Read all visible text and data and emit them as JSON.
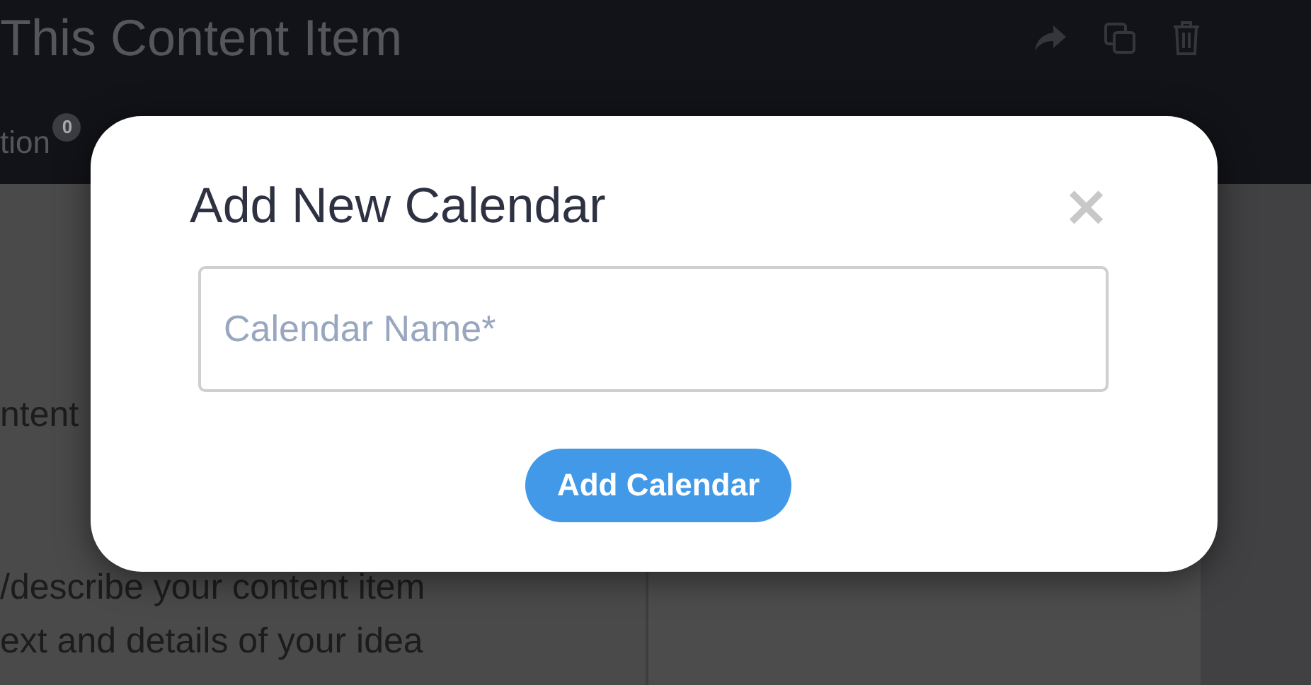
{
  "header": {
    "title": "This Content Item",
    "tab": {
      "label": "tion",
      "badge": "0"
    }
  },
  "content": {
    "lines": [
      "ntent",
      "/describe your content item",
      "ext and details of your idea"
    ]
  },
  "dialog": {
    "title": "Add New Calendar",
    "close": "×",
    "field": {
      "placeholder": "Calendar Name*"
    },
    "button": "Add Calendar"
  }
}
